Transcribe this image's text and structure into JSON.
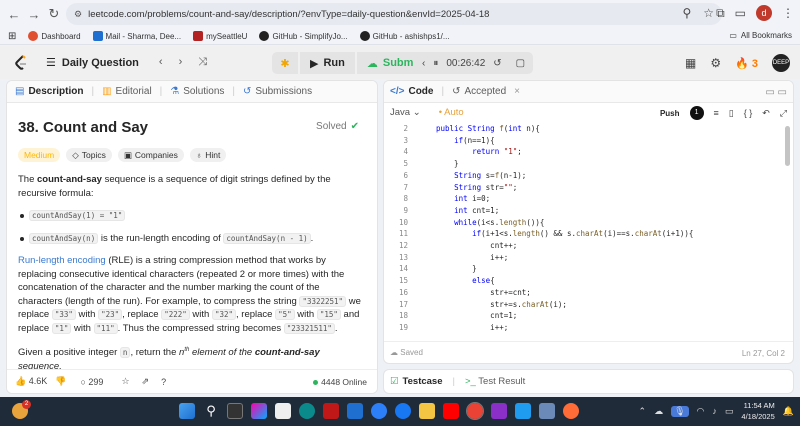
{
  "browser": {
    "url": "leetcode.com/problems/count-and-say/description/?envType=daily-question&envId=2025-04-18",
    "profile_initial": "d",
    "bookmarks": [
      {
        "label": "Dashboard",
        "color": "#e04f2f"
      },
      {
        "label": "Mail - Sharma, Dee...",
        "color": "#1e6fd0"
      },
      {
        "label": "mySeattleU",
        "color": "#b22222"
      },
      {
        "label": "GitHub - SimplifyJo...",
        "color": "#222222"
      },
      {
        "label": "GitHub - ashishps1/...",
        "color": "#222222"
      }
    ],
    "all_bookmarks": "All Bookmarks"
  },
  "nav": {
    "daily_question": "Daily Question",
    "run": "Run",
    "submit": "Submit",
    "timer": "00:26:42",
    "streak": "3",
    "avatar_text": "DEEP"
  },
  "left": {
    "tabs": [
      "Description",
      "Editorial",
      "Solutions",
      "Submissions"
    ],
    "title": "38. Count and Say",
    "solved": "Solved",
    "chips": [
      "Medium",
      "Topics",
      "Companies",
      "Hint"
    ],
    "p1_a": "The ",
    "p1_b": "count-and-say",
    "p1_c": " sequence is a sequence of digit strings defined by the recursive formula:",
    "li1_code": "countAndSay(1) = \"1\"",
    "li2_code": "countAndSay(n)",
    "li2_mid": " is the run-length encoding of ",
    "li2_code2": "countAndSay(n - 1)",
    "li2_end": ".",
    "p2_link": "Run-length encoding",
    "p2_a": " (RLE) is a string compression method that works by replacing consecutive identical characters (repeated 2 or more times) with the concatenation of the character and the number marking the count of the characters (length of the run). For example, to compress the string ",
    "p2_c1": "\"3322251\"",
    "p2_b": " we replace ",
    "p2_c2": "\"33\"",
    "p2_with1": " with ",
    "p2_c3": "\"23\"",
    "p2_replace": ", replace ",
    "p2_c4": "\"222\"",
    "p2_with2": " with ",
    "p2_c5": "\"32\"",
    "p2_replace2": ", replace ",
    "p2_c6": "\"5\"",
    "p2_with3": " with ",
    "p2_c7": "\"15\"",
    "p2_and": " and replace ",
    "p2_c8": "\"1\"",
    "p2_with4": " with ",
    "p2_c9": "\"11\"",
    "p2_thus": ". Thus the compressed string becomes ",
    "p2_c10": "\"23321511\"",
    "p2_end": ".",
    "p3_a": "Given a positive integer ",
    "p3_code": "n",
    "p3_b": ", return the ",
    "p3_sup_n": "n",
    "p3_sup": "th",
    "p3_c": " element of the ",
    "p3_d": "count-and-say",
    "p3_e": " sequence.",
    "likes": "4.6K",
    "comments": "299",
    "online": "4448 Online"
  },
  "right": {
    "tab_code": "Code",
    "tab_accepted": "Accepted",
    "language": "Java",
    "auto": "Auto",
    "push": "Push",
    "saved": "Saved",
    "cursor": "Ln 27, Col 2",
    "line_numbers": [
      "2",
      "3",
      "4",
      "5",
      "6",
      "7",
      "8",
      "9",
      "10",
      "11",
      "12",
      "13",
      "14",
      "15",
      "16",
      "17",
      "18",
      "19"
    ],
    "code_lines": [
      "public String f(int n){",
      "    if(n==1){",
      "        return \"1\";",
      "    }",
      "    String s=f(n-1);",
      "    String str=\"\";",
      "    int i=0;",
      "    int cnt=1;",
      "    while(i<s.length()){",
      "        if(i+1<s.length() && s.charAt(i)==s.charAt(i+1)){",
      "            cnt++;",
      "            i++;",
      "        }",
      "        else{",
      "            str+=cnt;",
      "            str+=s.charAt(i);",
      "            cnt=1;",
      "            i++;"
    ],
    "testcase": "Testcase",
    "test_result": "Test Result"
  },
  "taskbar": {
    "time": "11:54 AM",
    "date": "4/18/2025",
    "notif_count": "2"
  }
}
